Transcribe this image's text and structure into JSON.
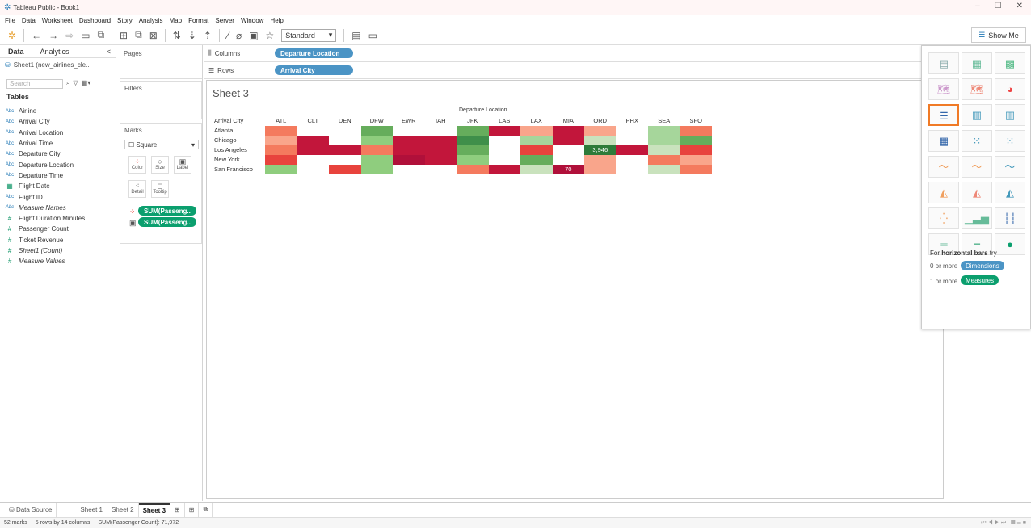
{
  "window": {
    "title": "Tableau Public - Book1",
    "controls": [
      "–",
      "☐",
      "✕"
    ]
  },
  "menu": [
    "File",
    "Data",
    "Worksheet",
    "Dashboard",
    "Story",
    "Analysis",
    "Map",
    "Format",
    "Server",
    "Window",
    "Help"
  ],
  "toolbar": {
    "fit_select": "Standard",
    "show_me": "Show Me"
  },
  "left_panel": {
    "tab_data": "Data",
    "tab_analytics": "Analytics",
    "collapse": "<",
    "datasource": "Sheet1 (new_airlines_cle...",
    "search_placeholder": "Search",
    "tables_label": "Tables",
    "fields": [
      {
        "type": "Abc",
        "name": "Airline",
        "italic": false,
        "kind": "str"
      },
      {
        "type": "Abc",
        "name": "Arrival City",
        "italic": false,
        "kind": "str"
      },
      {
        "type": "Abc",
        "name": "Arrival Location",
        "italic": false,
        "kind": "str"
      },
      {
        "type": "Abc",
        "name": "Arrival Time",
        "italic": false,
        "kind": "str"
      },
      {
        "type": "Abc",
        "name": "Departure City",
        "italic": false,
        "kind": "str"
      },
      {
        "type": "Abc",
        "name": "Departure Location",
        "italic": false,
        "kind": "str"
      },
      {
        "type": "Abc",
        "name": "Departure Time",
        "italic": false,
        "kind": "str"
      },
      {
        "type": "▦",
        "name": "Flight Date",
        "italic": false,
        "kind": "cal"
      },
      {
        "type": "Abc",
        "name": "Flight ID",
        "italic": false,
        "kind": "str"
      },
      {
        "type": "Abc",
        "name": "Measure Names",
        "italic": true,
        "kind": "str"
      },
      {
        "type": "#",
        "name": "Flight Duration Minutes",
        "italic": false,
        "kind": "num"
      },
      {
        "type": "#",
        "name": "Passenger Count",
        "italic": false,
        "kind": "num"
      },
      {
        "type": "#",
        "name": "Ticket Revenue",
        "italic": false,
        "kind": "num"
      },
      {
        "type": "#",
        "name": "Sheet1 (Count)",
        "italic": true,
        "kind": "num"
      },
      {
        "type": "#",
        "name": "Measure Values",
        "italic": true,
        "kind": "num"
      }
    ]
  },
  "cards": {
    "pages": "Pages",
    "filters": "Filters",
    "marks": "Marks",
    "mark_type": "Square",
    "mark_buttons": [
      "Color",
      "Size",
      "Label",
      "Detail",
      "Tooltip"
    ],
    "mark_pills": [
      "SUM(Passeng..",
      "SUM(Passeng.."
    ]
  },
  "shelves": {
    "columns_label": "Columns",
    "rows_label": "Rows",
    "columns_pill": "Departure Location",
    "rows_pill": "Arrival City"
  },
  "view": {
    "sheet_title": "Sheet 3",
    "column_header_title": "Departure Location",
    "row_header_title": "Arrival City",
    "columns": [
      "ATL",
      "CLT",
      "DEN",
      "DFW",
      "EWR",
      "IAH",
      "JFK",
      "LAS",
      "LAX",
      "MIA",
      "ORD",
      "PHX",
      "SEA",
      "SFO"
    ],
    "rows": [
      "Atlanta",
      "Chicago",
      "Los Angeles",
      "New York",
      "San Francisco"
    ],
    "cell_colors": [
      [
        "#f47a5e",
        "#ffffff",
        "#ffffff",
        "#66ad5c",
        "#ffffff",
        "#ffffff",
        "#66ad5c",
        "#c2163b",
        "#f9a58b",
        "#c2163b",
        "#f9a58b",
        "#ffffff",
        "#a6d69b",
        "#f47a5e"
      ],
      [
        "#f9a58b",
        "#c2163b",
        "#ffffff",
        "#8fcd7e",
        "#c2163b",
        "#c2163b",
        "#3f8f4a",
        "#ffffff",
        "#a6d69b",
        "#c2163b",
        "#c9e2bd",
        "#ffffff",
        "#a6d69b",
        "#66ad5c"
      ],
      [
        "#f47a5e",
        "#c2163b",
        "#c2163b",
        "#f47a5e",
        "#c2163b",
        "#c2163b",
        "#66ad5c",
        "#ffffff",
        "#e8433d",
        "#ffffff",
        "#2e7b3a",
        "#c2163b",
        "#c9e2bd",
        "#e8433d"
      ],
      [
        "#e8433d",
        "#ffffff",
        "#ffffff",
        "#8fcd7e",
        "#b0103a",
        "#c2163b",
        "#8fcd7e",
        "#ffffff",
        "#66ad5c",
        "#ffffff",
        "#f9a58b",
        "#ffffff",
        "#f47a5e",
        "#f9a58b"
      ],
      [
        "#8fcd7e",
        "#ffffff",
        "#e8433d",
        "#8fcd7e",
        "#ffffff",
        "#ffffff",
        "#f47a5e",
        "#c2163b",
        "#c9e2bd",
        "#b0103a",
        "#f9a58b",
        "#ffffff",
        "#c9e2bd",
        "#f47a5e"
      ]
    ],
    "cell_labels": [
      {
        "row": 2,
        "col": 10,
        "text": "3,946"
      },
      {
        "row": 4,
        "col": 9,
        "text": "70"
      }
    ]
  },
  "show_me": {
    "hint_prefix": "For ",
    "hint_bold": "horizontal bars",
    "hint_suffix": " try",
    "dim_prefix": "0 or more",
    "dim_pill": "Dimensions",
    "meas_prefix": "1 or more",
    "meas_pill": "Measures",
    "thumbnail_names": [
      "text-table",
      "heat-map",
      "highlight-table",
      "symbol-map",
      "filled-map",
      "pie-chart",
      "horizontal-bars",
      "stacked-bars",
      "side-by-side-bars",
      "treemap",
      "circle-views",
      "side-by-side-circles",
      "line-continuous",
      "line-discrete",
      "dual-lines",
      "area-continuous",
      "area-discrete",
      "dual-combination",
      "scatter-plot",
      "histogram",
      "box-and-whisker",
      "gantt-chart",
      "bullet-graph",
      "packed-bubbles"
    ]
  },
  "bottom_tabs": {
    "data_source": "Data Source",
    "sheets": [
      "Sheet 1",
      "Sheet 2",
      "Sheet 3"
    ],
    "active": "Sheet 3"
  },
  "status": {
    "marks": "52 marks",
    "dims": "5 rows by 14 columns",
    "sum": "SUM(Passenger Count): 71,972"
  }
}
